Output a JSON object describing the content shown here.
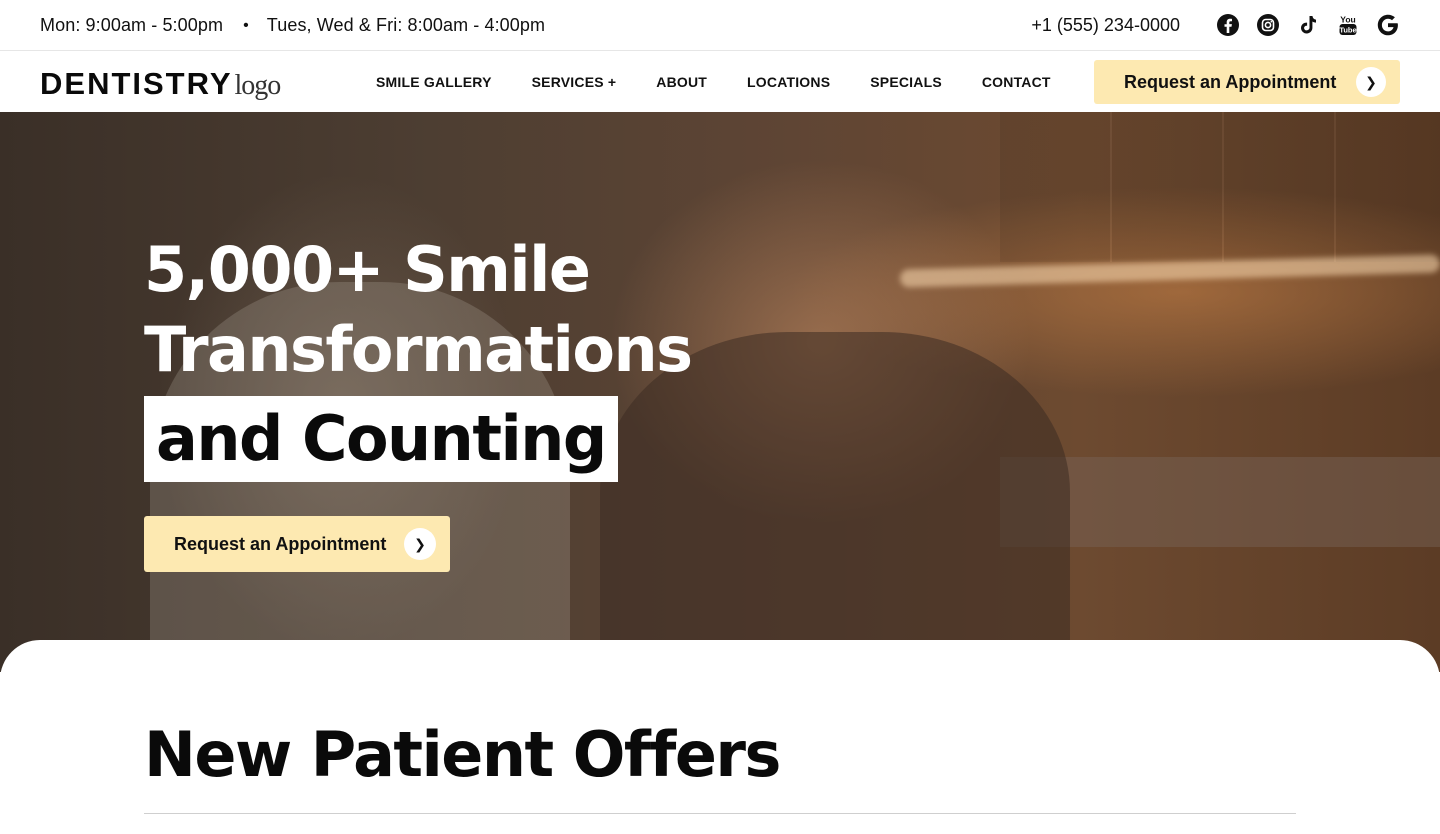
{
  "topbar": {
    "hours_weekday": "Mon: 9:00am - 5:00pm",
    "separator": "•",
    "hours_other": "Tues, Wed & Fri: 8:00am - 4:00pm",
    "phone": "+1 (555) 234-0000",
    "socials": [
      {
        "name": "facebook-icon"
      },
      {
        "name": "instagram-icon"
      },
      {
        "name": "tiktok-icon"
      },
      {
        "name": "youtube-icon",
        "text": "You Tube"
      },
      {
        "name": "google-icon"
      }
    ]
  },
  "header": {
    "logo_word": "DENTISTRY",
    "logo_sub": "logo",
    "nav": [
      "SMILE GALLERY",
      "SERVICES +",
      "ABOUT",
      "LOCATIONS",
      "SPECIALS",
      "CONTACT"
    ],
    "cta_label": "Request an Appointment",
    "cta_arrow": "❯"
  },
  "hero": {
    "line1": "5,000+ Smile",
    "line2": "Transformations",
    "line3": "and Counting",
    "cta_label": "Request an Appointment",
    "cta_arrow": "❯"
  },
  "offers": {
    "title": "New Patient Offers"
  },
  "colors": {
    "accent": "#fde9b1",
    "text": "#0a0a0a"
  }
}
